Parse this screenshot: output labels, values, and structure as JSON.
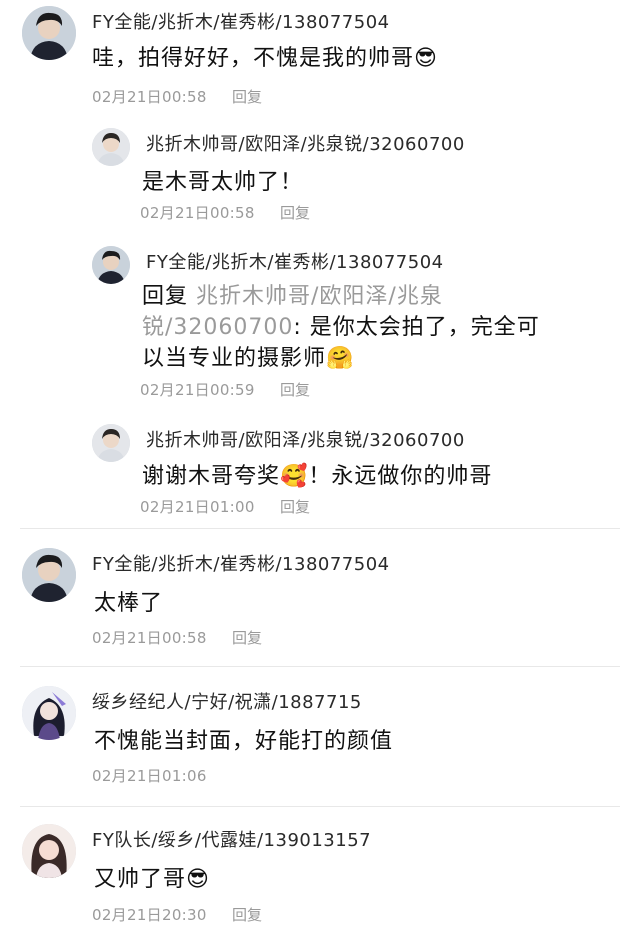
{
  "comments": [
    {
      "username": "FY全能/兆折木/崔秀彬/138077504",
      "text": "哇，拍得好好，不愧是我的帅哥",
      "emoji": "😎",
      "time": "02月21日00:58",
      "reply_label": "回复",
      "avatar_icon": "user-avatar-dark-hair",
      "replies": [
        {
          "username": "兆折木帅哥/欧阳泽/兆泉锐/32060700",
          "text": "是木哥太帅了！",
          "time": "02月21日00:58",
          "reply_label": "回复",
          "avatar_icon": "user-avatar-light"
        },
        {
          "username": "FY全能/兆折木/崔秀彬/138077504",
          "reply_prefix": "回复",
          "mention": "兆折木帅哥/欧阳泽/兆泉锐/32060700",
          "text": ": 是你太会拍了，完全可以当专业的摄影师",
          "emoji": "🤗",
          "time": "02月21日00:59",
          "reply_label": "回复",
          "avatar_icon": "user-avatar-dark-hair"
        },
        {
          "username": "兆折木帅哥/欧阳泽/兆泉锐/32060700",
          "text_before": "谢谢木哥夸奖",
          "emoji": "🥰",
          "text_after": "！永远做你的帅哥",
          "time": "02月21日01:00",
          "reply_label": "回复",
          "avatar_icon": "user-avatar-light"
        }
      ]
    },
    {
      "username": "FY全能/兆折木/崔秀彬/138077504",
      "text": "太棒了",
      "time": "02月21日00:58",
      "reply_label": "回复",
      "avatar_icon": "user-avatar-dark-hair"
    },
    {
      "username": "绥乡经纪人/宁好/祝潇/1887715",
      "text": "不愧能当封面，好能打的颜值",
      "time": "02月21日01:06",
      "avatar_icon": "user-avatar-anime"
    },
    {
      "username": "FY队长/绥乡/代露娃/139013157",
      "text": "又帅了哥",
      "emoji": "😎",
      "time": "02月21日20:30",
      "reply_label": "回复",
      "avatar_icon": "user-avatar-girl"
    }
  ]
}
